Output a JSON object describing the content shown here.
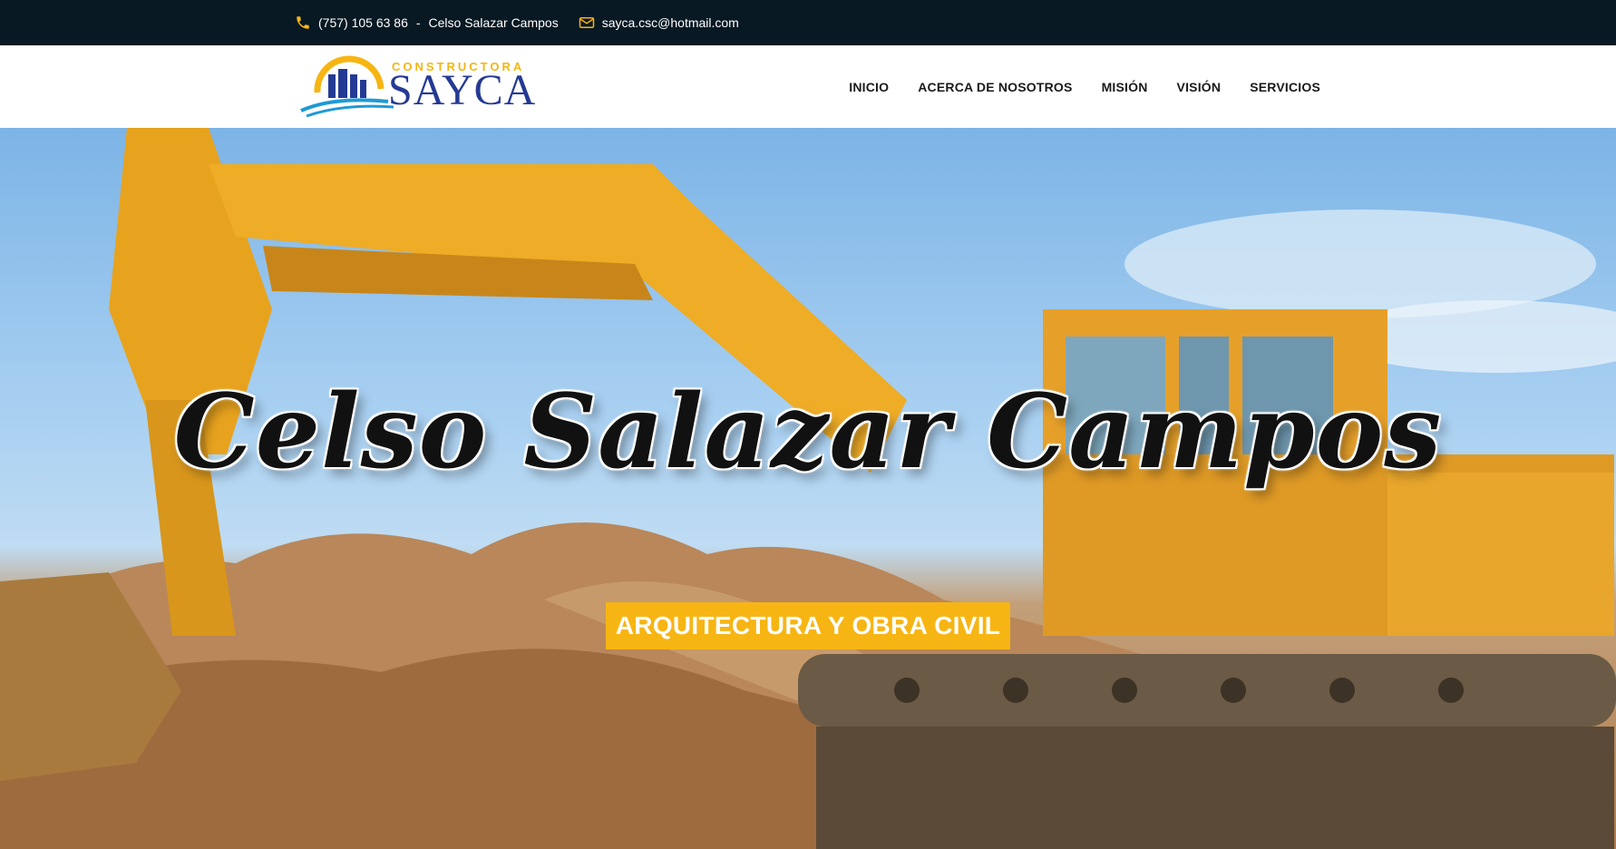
{
  "topbar": {
    "phone": "(757) 105 63 86",
    "separator": "-",
    "name": "Celso Salazar Campos",
    "email": "sayca.csc@hotmail.com"
  },
  "logo": {
    "small_text": "CONSTRUCTORA",
    "big_text": "SAYCA"
  },
  "nav": {
    "items": [
      "INICIO",
      "ACERCA DE NOSOTROS",
      "MISIÓN",
      "VISIÓN",
      "SERVICIOS"
    ]
  },
  "hero": {
    "title": "Celso Salazar Campos",
    "badge": "ARQUITECTURA Y OBRA CIVIL"
  },
  "colors": {
    "topbar_bg": "#081923",
    "accent": "#f7b514",
    "logo_blue": "#253a94"
  },
  "icons": {
    "phone": "phone-icon",
    "email": "envelope-icon"
  }
}
